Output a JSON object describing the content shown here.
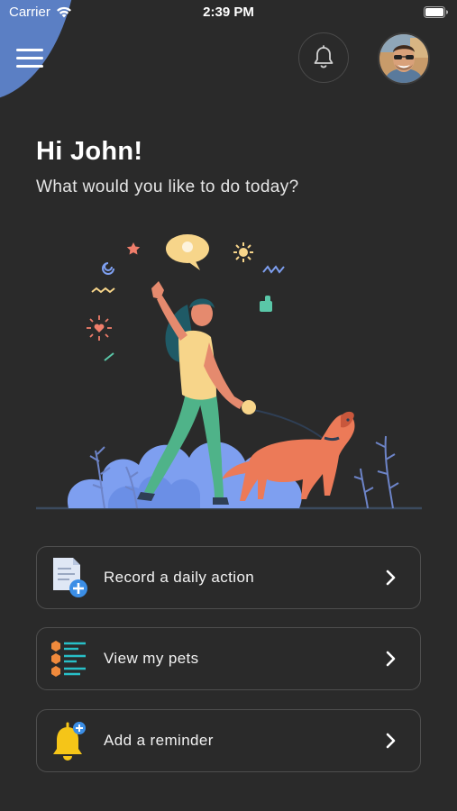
{
  "status_bar": {
    "carrier": "Carrier",
    "time": "2:39 PM",
    "wifi_icon": "wifi-icon",
    "battery_icon": "battery-icon"
  },
  "header": {
    "menu_icon": "hamburger-menu-icon",
    "notification_icon": "bell-icon",
    "avatar": "user-avatar",
    "accent_color": "#5b7fc4"
  },
  "greeting": {
    "title": "Hi John!",
    "subtitle": "What would you like to do today?"
  },
  "illustration": {
    "name": "woman-walking-dog-illustration"
  },
  "actions": [
    {
      "label": "Record a daily action",
      "icon": "document-add-icon",
      "chevron": "chevron-right-icon"
    },
    {
      "label": "View my pets",
      "icon": "pet-list-icon",
      "chevron": "chevron-right-icon"
    },
    {
      "label": "Add a reminder",
      "icon": "bell-add-icon",
      "chevron": "chevron-right-icon"
    }
  ],
  "colors": {
    "background": "#2a2a2a",
    "card_border": "#4e4e4e",
    "text": "#ffffff"
  }
}
